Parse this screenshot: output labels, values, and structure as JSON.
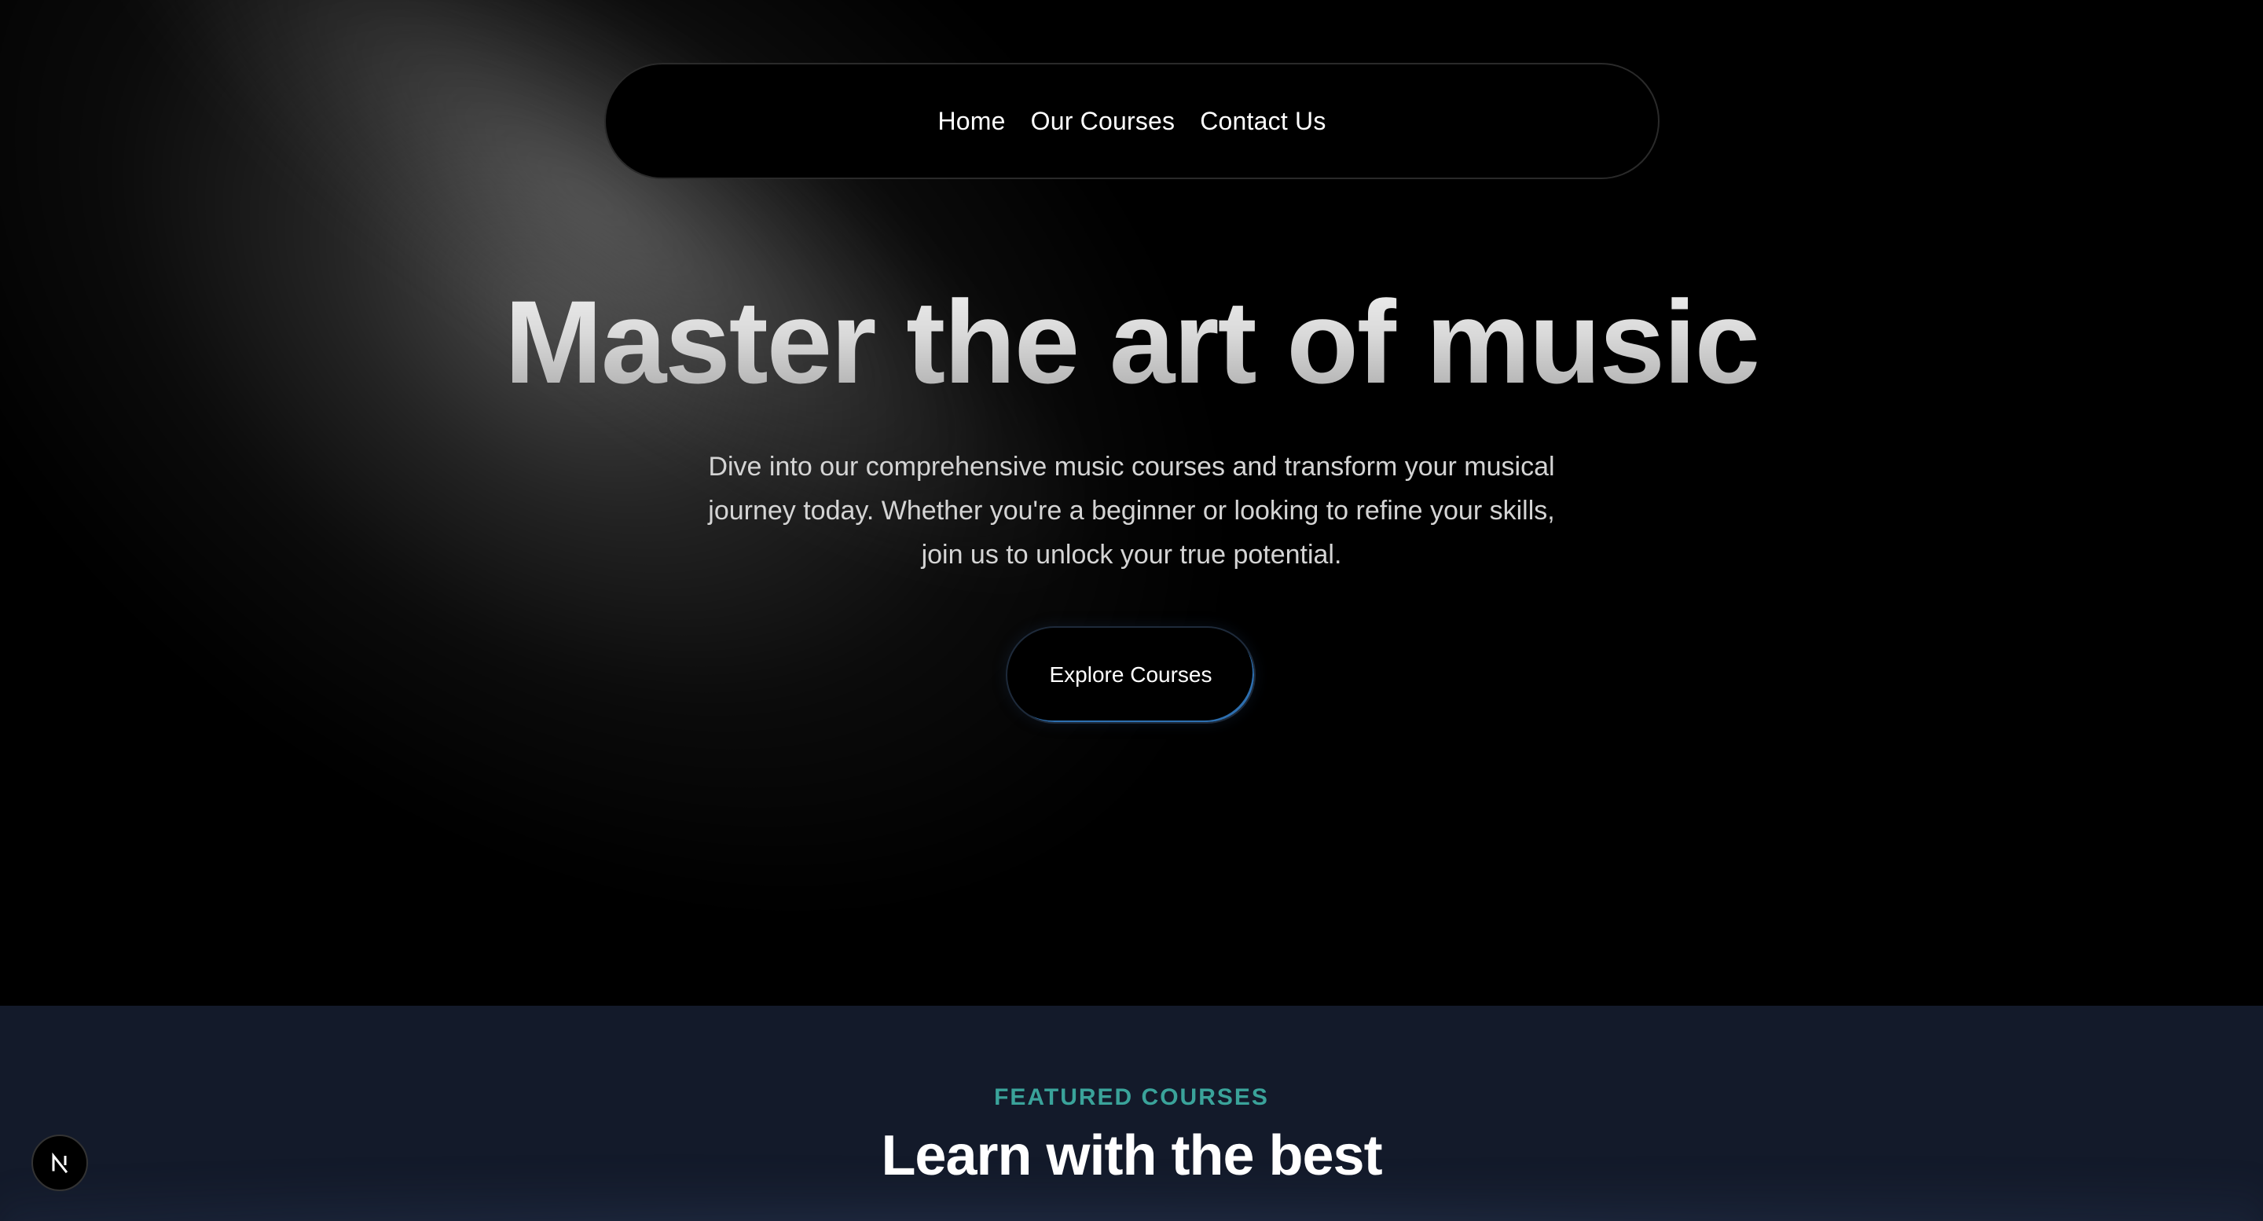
{
  "nav": {
    "items": [
      {
        "label": "Home"
      },
      {
        "label": "Our Courses"
      },
      {
        "label": "Contact Us"
      }
    ]
  },
  "hero": {
    "headline": "Master the art of music",
    "subtext": "Dive into our comprehensive music courses and transform your musical journey today. Whether you're a beginner or looking to refine your skills, join us to unlock your true potential.",
    "cta_label": "Explore Courses"
  },
  "featured": {
    "eyebrow": "FEATURED COURSES",
    "title": "Learn with the best"
  },
  "dev_badge": {
    "icon": "nextjs-logo-icon"
  },
  "colors": {
    "background": "#000000",
    "featured_background": "#131a2a",
    "accent_teal": "#3aa39a",
    "cta_border_accent": "#2d6fb0"
  }
}
